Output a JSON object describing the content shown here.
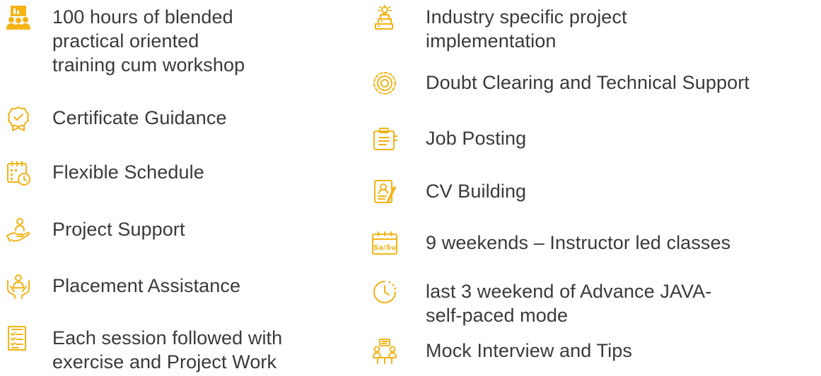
{
  "colors": {
    "accent": "#f5b316",
    "text": "#3a3a3a"
  },
  "left": [
    {
      "icon": "group-training-icon",
      "text": "100 hours of blended\npractical oriented\ntraining cum workshop"
    },
    {
      "icon": "certificate-badge-icon",
      "text": "Certificate Guidance"
    },
    {
      "icon": "calendar-clock-icon",
      "text": "Flexible Schedule"
    },
    {
      "icon": "hand-person-icon",
      "text": "Project Support"
    },
    {
      "icon": "placement-hands-icon",
      "text": "Placement Assistance"
    },
    {
      "icon": "checklist-document-icon",
      "text": "Each session followed with\nexercise and Project Work"
    }
  ],
  "right": [
    {
      "icon": "idea-stack-icon",
      "text": "Industry specific project\nimplementation"
    },
    {
      "icon": "gear-support-icon",
      "text": "Doubt Clearing and Technical Support"
    },
    {
      "icon": "job-clipboard-icon",
      "text": "Job Posting"
    },
    {
      "icon": "cv-document-icon",
      "text": "CV Building"
    },
    {
      "icon": "weekend-calendar-icon",
      "icon_text": "Sa/Su",
      "text": " 9 weekends – Instructor led classes"
    },
    {
      "icon": "clock-icon",
      "text": "last 3 weekend of Advance JAVA-\nself-paced mode"
    },
    {
      "icon": "interview-people-icon",
      "text": "Mock Interview and Tips"
    }
  ]
}
